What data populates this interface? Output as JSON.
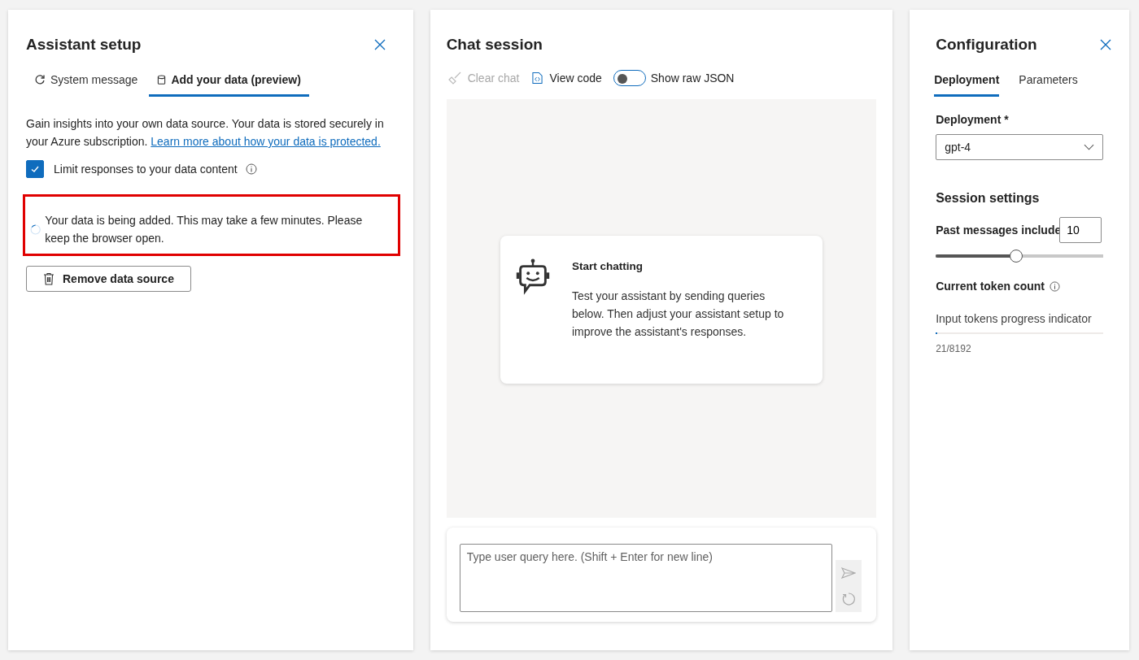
{
  "setup": {
    "title": "Assistant setup",
    "tabs": [
      {
        "label": "System message",
        "kind": "refresh",
        "selected": false
      },
      {
        "label": "Add your data (preview)",
        "kind": "database",
        "selected": true
      }
    ],
    "description": "Gain insights into your own data source. Your data is stored securely in your Azure subscription.",
    "link": "Learn more about how your data is protected.",
    "limit_checkbox": {
      "label": "Limit responses to your data content",
      "checked": true
    },
    "status": {
      "message": "Your data is being added. This may take a few minutes. Please keep the browser open.",
      "highlighted": true
    },
    "remove_button": "Remove data source"
  },
  "chat": {
    "title": "Chat session",
    "toolbar": [
      {
        "label": "Clear chat",
        "kind": "clear",
        "disabled": true
      },
      {
        "label": "View code",
        "kind": "code",
        "disabled": false
      }
    ],
    "raw_json_toggle": {
      "label": "Show raw JSON",
      "on": false
    },
    "card": {
      "title": "Start chatting",
      "body": "Test your assistant by sending queries below. Then adjust your assistant setup to improve the assistant's responses."
    },
    "input": {
      "placeholder": "Type user query here. (Shift + Enter for new line)"
    }
  },
  "config": {
    "title": "Configuration",
    "tabs": [
      {
        "label": "Deployment",
        "selected": true
      },
      {
        "label": "Parameters",
        "selected": false
      }
    ],
    "deployment_label": "Deployment *",
    "deployment_value": "gpt-4",
    "session_title": "Session settings",
    "past_messages": {
      "label": "Past messages include",
      "value": "10",
      "level": 0.48
    },
    "token_count_label": "Current token count",
    "token_progress": {
      "label": "Input tokens progress indicator",
      "level": 0.01,
      "reading": "21/8192"
    }
  }
}
